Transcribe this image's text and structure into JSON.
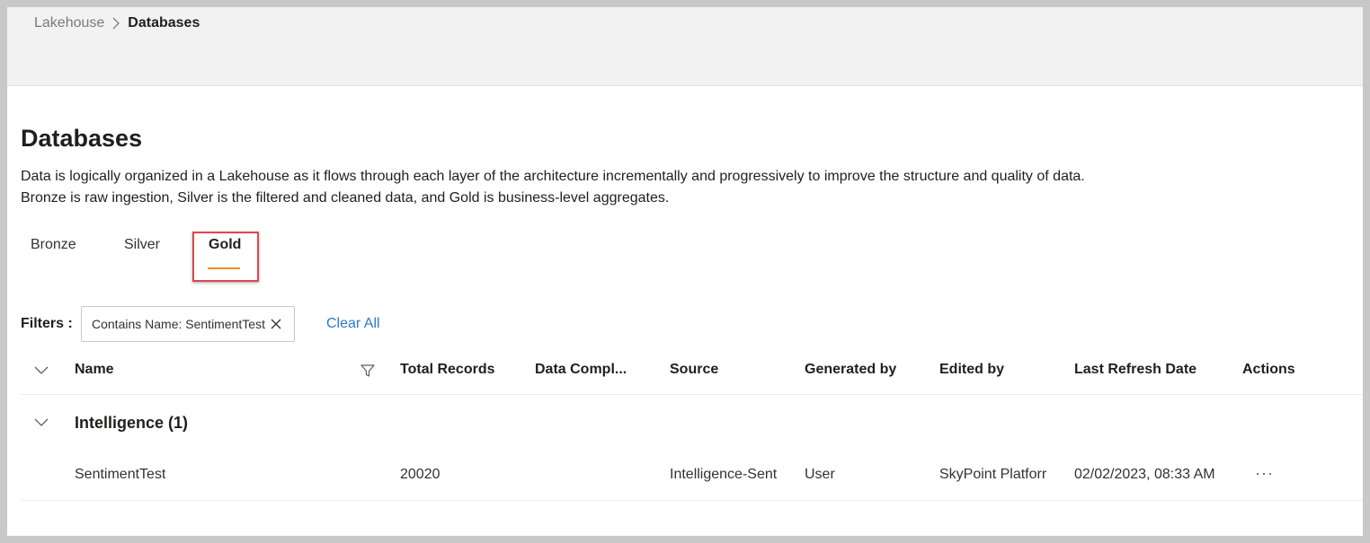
{
  "breadcrumb": {
    "parent": "Lakehouse",
    "current": "Databases"
  },
  "page": {
    "title": "Databases",
    "description_line1": "Data is logically organized in a Lakehouse as it flows through each layer of the architecture incrementally and progressively to improve the structure and quality of data.",
    "description_line2": "Bronze is raw ingestion, Silver is the filtered and cleaned data, and Gold is business-level aggregates."
  },
  "tabs": [
    {
      "label": "Bronze",
      "selected": false
    },
    {
      "label": "Silver",
      "selected": false
    },
    {
      "label": "Gold",
      "selected": true
    }
  ],
  "filters": {
    "label": "Filters :",
    "chip": "Contains Name: SentimentTest",
    "clear_all": "Clear All"
  },
  "table": {
    "columns": [
      "Name",
      "Total Records",
      "Data Compl...",
      "Source",
      "Generated by",
      "Edited by",
      "Last Refresh Date",
      "Actions"
    ],
    "group": {
      "title": "Intelligence (1)"
    },
    "rows": [
      {
        "name": "SentimentTest",
        "total_records": "20020",
        "data_completeness": "",
        "source": "Intelligence-Sent",
        "generated_by": "User",
        "edited_by": "SkyPoint Platforr",
        "last_refresh": "02/02/2023, 08:33 AM",
        "actions": "···"
      }
    ]
  },
  "colors": {
    "accent_tab": "#e8921a",
    "link": "#2b78d4",
    "highlight": "#e0474c"
  }
}
